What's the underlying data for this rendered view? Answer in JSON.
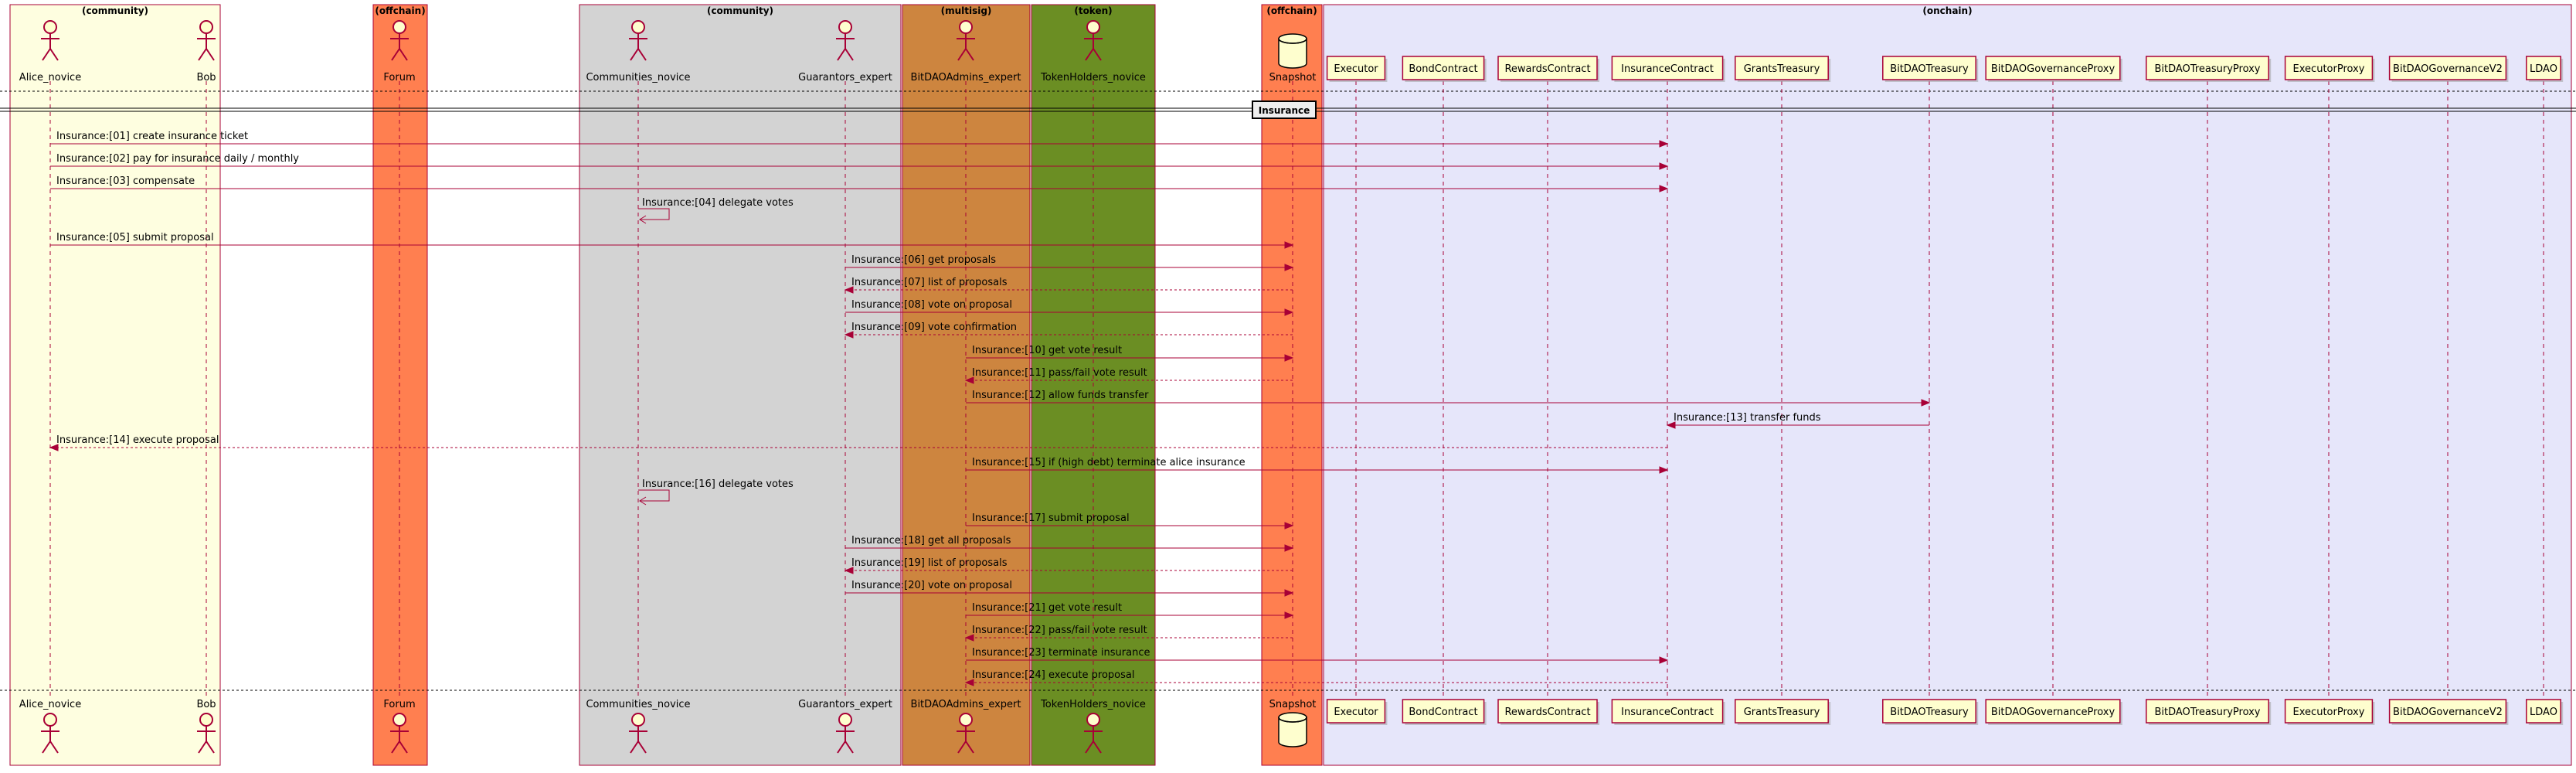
{
  "boxes": [
    {
      "title": "(community)",
      "fill": "#FEFEE0",
      "participants": [
        "Alice_novice",
        "Bob"
      ]
    },
    {
      "title": "(offchain)",
      "fill": "#FF7F50",
      "participants": [
        "Forum"
      ]
    },
    {
      "title": "(community)",
      "fill": "#D3D3D3",
      "participants": [
        "Communities_novice",
        "Guarantors_expert"
      ]
    },
    {
      "title": "(multisig)",
      "fill": "#CD853F",
      "participants": [
        "BitDAOAdmins_expert"
      ]
    },
    {
      "title": "(token)",
      "fill": "#6B8E23",
      "participants": [
        "TokenHolders_novice"
      ]
    },
    {
      "title": "(offchain)",
      "fill": "#FF7F50",
      "participants": [
        "Snapshot"
      ]
    },
    {
      "title": "(onchain)",
      "fill": "#E6E6FA",
      "participants": [
        "Executor",
        "BondContract",
        "RewardsContract",
        "InsuranceContract",
        "GrantsTreasury",
        "BitDAOTreasury",
        "BitDAOGovernanceProxy",
        "BitDAOTreasuryProxy",
        "ExecutorProxy",
        "BitDAOGovernanceV2",
        "LDAO"
      ]
    }
  ],
  "participants": [
    {
      "id": "Alice_novice",
      "label": "Alice_novice",
      "kind": "actor"
    },
    {
      "id": "Bob",
      "label": "Bob",
      "kind": "actor"
    },
    {
      "id": "Forum",
      "label": "Forum",
      "kind": "actor"
    },
    {
      "id": "Communities_novice",
      "label": "Communities_novice",
      "kind": "actor"
    },
    {
      "id": "Guarantors_expert",
      "label": "Guarantors_expert",
      "kind": "actor"
    },
    {
      "id": "BitDAOAdmins_expert",
      "label": "BitDAOAdmins_expert",
      "kind": "actor"
    },
    {
      "id": "TokenHolders_novice",
      "label": "TokenHolders_novice",
      "kind": "actor"
    },
    {
      "id": "Snapshot",
      "label": "Snapshot",
      "kind": "database"
    },
    {
      "id": "Executor",
      "label": "Executor",
      "kind": "participant"
    },
    {
      "id": "BondContract",
      "label": "BondContract",
      "kind": "participant"
    },
    {
      "id": "RewardsContract",
      "label": "RewardsContract",
      "kind": "participant"
    },
    {
      "id": "InsuranceContract",
      "label": "InsuranceContract",
      "kind": "participant"
    },
    {
      "id": "GrantsTreasury",
      "label": "GrantsTreasury",
      "kind": "participant"
    },
    {
      "id": "BitDAOTreasury",
      "label": "BitDAOTreasury",
      "kind": "participant"
    },
    {
      "id": "BitDAOGovernanceProxy",
      "label": "BitDAOGovernanceProxy",
      "kind": "participant"
    },
    {
      "id": "BitDAOTreasuryProxy",
      "label": "BitDAOTreasuryProxy",
      "kind": "participant"
    },
    {
      "id": "ExecutorProxy",
      "label": "ExecutorProxy",
      "kind": "participant"
    },
    {
      "id": "BitDAOGovernanceV2",
      "label": "BitDAOGovernanceV2",
      "kind": "participant"
    },
    {
      "id": "LDAO",
      "label": "LDAO",
      "kind": "participant"
    }
  ],
  "section_label": "Insurance",
  "messages": [
    {
      "from": "Alice_novice",
      "to": "InsuranceContract",
      "text": "Insurance:[01] create insurance ticket",
      "style": "solid"
    },
    {
      "from": "Alice_novice",
      "to": "InsuranceContract",
      "text": "Insurance:[02] pay for insurance daily / monthly",
      "style": "solid"
    },
    {
      "from": "Alice_novice",
      "to": "InsuranceContract",
      "text": "Insurance:[03] compensate",
      "style": "solid"
    },
    {
      "from": "Communities_novice",
      "to": "Communities_novice",
      "text": "Insurance:[04] delegate votes",
      "style": "self"
    },
    {
      "from": "Alice_novice",
      "to": "Snapshot",
      "text": "Insurance:[05] submit proposal",
      "style": "solid"
    },
    {
      "from": "Guarantors_expert",
      "to": "Snapshot",
      "text": "Insurance:[06] get proposals",
      "style": "solid"
    },
    {
      "from": "Snapshot",
      "to": "Guarantors_expert",
      "text": "Insurance:[07] list of proposals",
      "style": "dashed"
    },
    {
      "from": "Guarantors_expert",
      "to": "Snapshot",
      "text": "Insurance:[08] vote on proposal",
      "style": "solid"
    },
    {
      "from": "Snapshot",
      "to": "Guarantors_expert",
      "text": "Insurance:[09] vote confirmation",
      "style": "dashed"
    },
    {
      "from": "BitDAOAdmins_expert",
      "to": "Snapshot",
      "text": "Insurance:[10] get vote result",
      "style": "solid"
    },
    {
      "from": "Snapshot",
      "to": "BitDAOAdmins_expert",
      "text": "Insurance:[11] pass/fail vote result",
      "style": "dashed"
    },
    {
      "from": "BitDAOAdmins_expert",
      "to": "BitDAOTreasury",
      "text": "Insurance:[12] allow funds transfer",
      "style": "solid"
    },
    {
      "from": "BitDAOTreasury",
      "to": "InsuranceContract",
      "text": "Insurance:[13] transfer funds",
      "style": "solid"
    },
    {
      "from": "InsuranceContract",
      "to": "Alice_novice",
      "text": "Insurance:[14] execute proposal",
      "style": "dashed"
    },
    {
      "from": "BitDAOAdmins_expert",
      "to": "InsuranceContract",
      "text": "Insurance:[15] if (high debt) terminate alice insurance",
      "style": "solid"
    },
    {
      "from": "Communities_novice",
      "to": "Communities_novice",
      "text": "Insurance:[16] delegate votes",
      "style": "self"
    },
    {
      "from": "BitDAOAdmins_expert",
      "to": "Snapshot",
      "text": "Insurance:[17] submit proposal",
      "style": "solid"
    },
    {
      "from": "Guarantors_expert",
      "to": "Snapshot",
      "text": "Insurance:[18] get all proposals",
      "style": "solid"
    },
    {
      "from": "Snapshot",
      "to": "Guarantors_expert",
      "text": "Insurance:[19] list of proposals",
      "style": "dashed"
    },
    {
      "from": "Guarantors_expert",
      "to": "Snapshot",
      "text": "Insurance:[20] vote on proposal",
      "style": "solid"
    },
    {
      "from": "BitDAOAdmins_expert",
      "to": "Snapshot",
      "text": "Insurance:[21] get vote result",
      "style": "solid"
    },
    {
      "from": "Snapshot",
      "to": "BitDAOAdmins_expert",
      "text": "Insurance:[22] pass/fail vote result",
      "style": "dashed"
    },
    {
      "from": "BitDAOAdmins_expert",
      "to": "InsuranceContract",
      "text": "Insurance:[23] terminate insurance",
      "style": "solid"
    },
    {
      "from": "InsuranceContract",
      "to": "BitDAOAdmins_expert",
      "text": "Insurance:[24] execute proposal",
      "style": "dashed"
    }
  ],
  "colors": {
    "arrow": "#A80036",
    "lifeline": "#A80036",
    "participant_fill": "#FEFECE",
    "box_border": "#A80036",
    "text": "#000000"
  }
}
